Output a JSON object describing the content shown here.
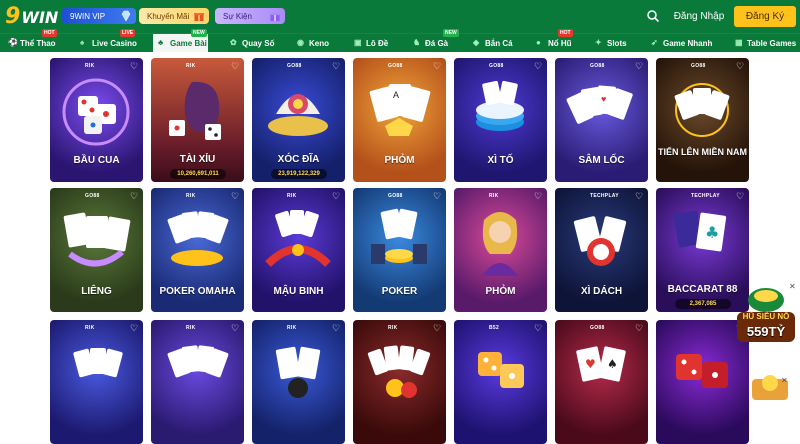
{
  "header": {
    "logo_main": "9",
    "logo_sub": "WIN",
    "promos": [
      {
        "label": "9WIN VIP",
        "icon": "diamond-icon"
      },
      {
        "label": "Khuyến Mãi",
        "icon": "gift-icon"
      },
      {
        "label": "Sự Kiện",
        "icon": "gift-icon"
      }
    ],
    "login_label": "Đăng Nhập",
    "register_label": "Đăng Ký",
    "search_icon": "search-icon"
  },
  "nav": {
    "items": [
      {
        "label": "Thể Thao",
        "badge": "HOT",
        "icon": "ball-icon"
      },
      {
        "label": "Live Casino",
        "badge": "LIVE",
        "icon": "dealer-icon"
      },
      {
        "label": "Game Bài",
        "badge": "NEW",
        "icon": "cards-icon",
        "active": true
      },
      {
        "label": "Quay Số",
        "badge": "",
        "icon": "lottery-icon"
      },
      {
        "label": "Keno",
        "badge": "",
        "icon": "keno-icon"
      },
      {
        "label": "Lô Đề",
        "badge": "",
        "icon": "ticket-icon"
      },
      {
        "label": "Đá Gà",
        "badge": "NEW",
        "icon": "rooster-icon"
      },
      {
        "label": "Bắn Cá",
        "badge": "",
        "icon": "fish-icon"
      },
      {
        "label": "Nổ Hũ",
        "badge": "HOT",
        "icon": "jar-icon"
      },
      {
        "label": "Slots",
        "badge": "",
        "icon": "slot-icon"
      },
      {
        "label": "Game Nhanh",
        "badge": "",
        "icon": "rocket-icon"
      },
      {
        "label": "Table Games",
        "badge": "",
        "icon": "table-icon"
      }
    ]
  },
  "games": [
    {
      "name": "BẦU CUA",
      "provider": "RIK",
      "jackpot": ""
    },
    {
      "name": "TÀI XỈU",
      "provider": "RIK",
      "jackpot": "10,260,691,011"
    },
    {
      "name": "XÓC ĐĨA",
      "provider": "GO88",
      "jackpot": "23,919,122,329"
    },
    {
      "name": "PHỎM",
      "provider": "GO88",
      "jackpot": ""
    },
    {
      "name": "XÌ TỐ",
      "provider": "GO88",
      "jackpot": ""
    },
    {
      "name": "SÂM LỐC",
      "provider": "GO88",
      "jackpot": ""
    },
    {
      "name": "TIẾN LÊN MIỀN NAM",
      "provider": "GO88",
      "jackpot": ""
    },
    {
      "name": "LIÊNG",
      "provider": "GO88",
      "jackpot": ""
    },
    {
      "name": "POKER OMAHA",
      "provider": "RIK",
      "jackpot": ""
    },
    {
      "name": "MẬU BINH",
      "provider": "RIK",
      "jackpot": ""
    },
    {
      "name": "POKER",
      "provider": "GO88",
      "jackpot": ""
    },
    {
      "name": "PHỎM",
      "provider": "RIK",
      "jackpot": ""
    },
    {
      "name": "XÌ DÁCH",
      "provider": "TECHPLAY",
      "jackpot": ""
    },
    {
      "name": "BACCARAT 88",
      "provider": "TECHPLAY",
      "jackpot": "2,367,085"
    },
    {
      "name": "",
      "provider": "RIK",
      "jackpot": ""
    },
    {
      "name": "",
      "provider": "RIK",
      "jackpot": ""
    },
    {
      "name": "",
      "provider": "RIK",
      "jackpot": ""
    },
    {
      "name": "",
      "provider": "RIK",
      "jackpot": ""
    },
    {
      "name": "",
      "provider": "B52",
      "jackpot": ""
    },
    {
      "name": "",
      "provider": "GO88",
      "jackpot": ""
    },
    {
      "name": "",
      "provider": "",
      "jackpot": ""
    }
  ],
  "float_banner": {
    "title": "HŨ SIÊU NỔ",
    "amount": "559TỶ"
  },
  "colors": {
    "brand_green": "#0a7a3a",
    "accent_yellow": "#ffc21a"
  }
}
